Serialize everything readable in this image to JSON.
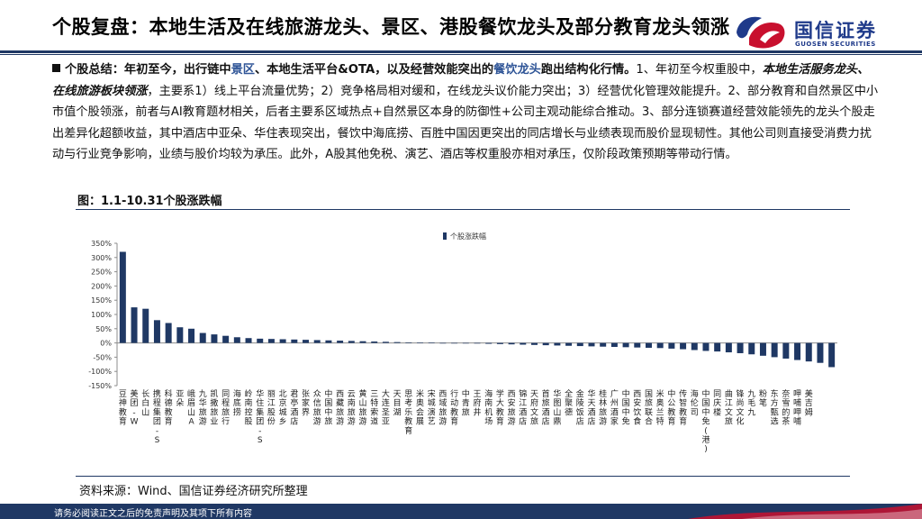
{
  "header": {
    "title": "个股复盘：本地生活及在线旅游龙头、景区、港股餐饮龙头及部分教育龙头领涨",
    "logo_cn": "国信证券",
    "logo_en": "GUOSEN SECURITIES"
  },
  "summary": {
    "s1": "个股总结：年初至今，出行链中",
    "s2": "景区",
    "s3": "、本地生活平台&OTA，以及经营效能突出的",
    "s4": "餐饮龙头",
    "s5": "跑出结构化行情。",
    "s6": "1、年初至今权重股中，",
    "s7": "本地生活服务龙头、在线旅游板块领涨",
    "s8": "，主要系1）线上平台流量优势；2）竞争格局相对缓和，在线龙头议价能力突出；3）经营优化管理效能提升。2、部分教育和自然景区中小市值个股领涨，前者与AI教育题材相关，后者主要系区域热点+自然景区本身的防御性+公司主观动能综合推动。3、部分连锁赛道经营效能领先的龙头个股走出差异化超额收益，其中酒店中亚朵、华住表现突出，餐饮中海底捞、百胜中国因更突出的同店增长与业绩表现而股价显现韧性。其他公司则直接受消费力扰动与行业竞争影响，业绩与股价均较为承压。此外，A股其他免税、演艺、酒店等权重股亦相对承压，仅阶段政策预期等带动行情。"
  },
  "figure": {
    "title": "图：1.1-10.31个股涨跌幅",
    "source": "资料来源：Wind、国信证券经济研究所整理"
  },
  "footer": {
    "disclaimer": "请务必阅读正文之后的免责声明及其项下所有内容"
  },
  "chart_data": {
    "type": "bar",
    "title": "",
    "xlabel": "",
    "ylabel": "",
    "ylim": [
      -150,
      350
    ],
    "yticks": [
      -150,
      -100,
      -50,
      0,
      50,
      100,
      150,
      200,
      250,
      300,
      350
    ],
    "ytick_format": "percent",
    "legend": "top-center",
    "bar_color": "#1f3864",
    "series": [
      {
        "name": "个股涨跌幅",
        "values": [
          320,
          125,
          120,
          80,
          70,
          55,
          50,
          35,
          30,
          25,
          20,
          17,
          15,
          14,
          13,
          12,
          11,
          10,
          9,
          8,
          7,
          6,
          5,
          4,
          3,
          2,
          1,
          1,
          0,
          0,
          -1,
          -2,
          -3,
          -4,
          -5,
          -6,
          -7,
          -8,
          -9,
          -10,
          -11,
          -12,
          -13,
          -14,
          -15,
          -16,
          -17,
          -18,
          -20,
          -22,
          -25,
          -28,
          -30,
          -33,
          -36,
          -40,
          -45,
          -50,
          -55,
          -60,
          -65,
          -70,
          -85
        ]
      }
    ],
    "categories": [
      "豆神教育",
      "美团-W",
      "长白山",
      "携程集团-S",
      "科德教育",
      "亚朵",
      "峨眉山A",
      "九华旅游",
      "凯撒旅业",
      "同程旅行",
      "海底捞",
      "岭南控股",
      "华住集团-S",
      "丽江股份",
      "北京城乡",
      "君亭酒店",
      "张家界",
      "众信旅游",
      "中国中旅",
      "西藏旅游",
      "云南旅游",
      "黄山旅游",
      "三特索道",
      "大连圣亚",
      "天目湖",
      "思考乐教育",
      "米奥会展",
      "宋城演艺",
      "西域旅游",
      "行动教育",
      "中青旅",
      "王府井",
      "海南机场",
      "学大教育",
      "西安旅游",
      "锦江酒店",
      "天府文旅",
      "首旅酒店",
      "华图山鼎",
      "全聚德",
      "金陵饭店",
      "华天酒店",
      "桂林旅游",
      "广州酒家",
      "中国中免",
      "西安饮食",
      "国旅联合",
      "米奥兰特",
      "中公教育",
      "传智教育",
      "海伦司",
      "中国中免(港)",
      "同庆楼",
      "曲江文旅",
      "锋尚文化",
      "九毛九",
      "粉笔",
      "东方甄选",
      "奈雪的茶",
      "呷哺呷哺",
      "美吉姆",
      "",
      ""
    ]
  }
}
